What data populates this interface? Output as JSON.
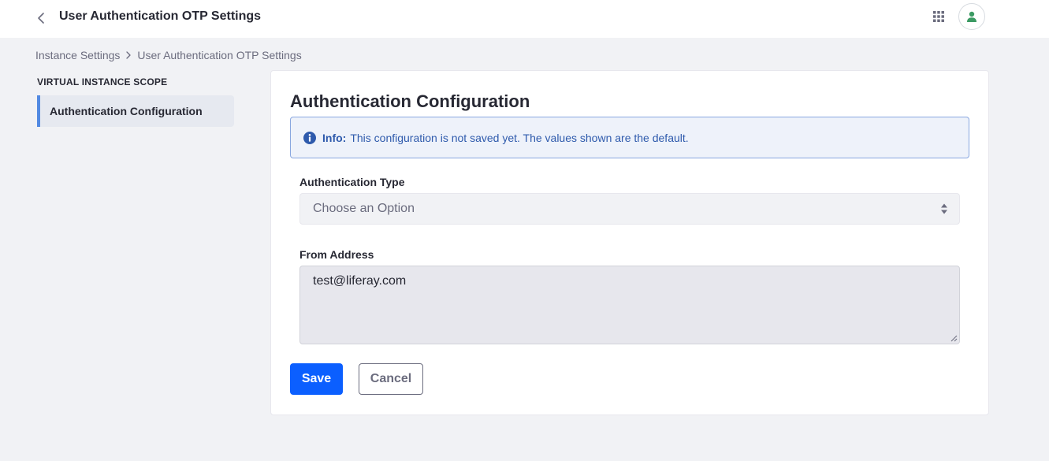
{
  "header": {
    "title": "User Authentication OTP Settings",
    "back_icon": "chevron-left-icon",
    "apps_icon": "grid-icon",
    "user_icon": "user-icon"
  },
  "breadcrumb": {
    "items": [
      "Instance Settings",
      "User Authentication OTP Settings"
    ]
  },
  "sidebar": {
    "scope_title": "VIRTUAL INSTANCE SCOPE",
    "items": [
      {
        "label": "Authentication Configuration",
        "active": true
      }
    ]
  },
  "main": {
    "title": "Authentication Configuration",
    "alert": {
      "lead": "Info:",
      "message": "This configuration is not saved yet. The values shown are the default."
    },
    "auth_type": {
      "label": "Authentication Type",
      "placeholder": "Choose an Option"
    },
    "from_address": {
      "label": "From Address",
      "value": "test@liferay.com"
    },
    "save_label": "Save",
    "cancel_label": "Cancel"
  },
  "colors": {
    "primary": "#0b5fff",
    "info": "#2e5aac",
    "avatar_icon": "#3b9a63",
    "background": "#f1f2f5"
  }
}
